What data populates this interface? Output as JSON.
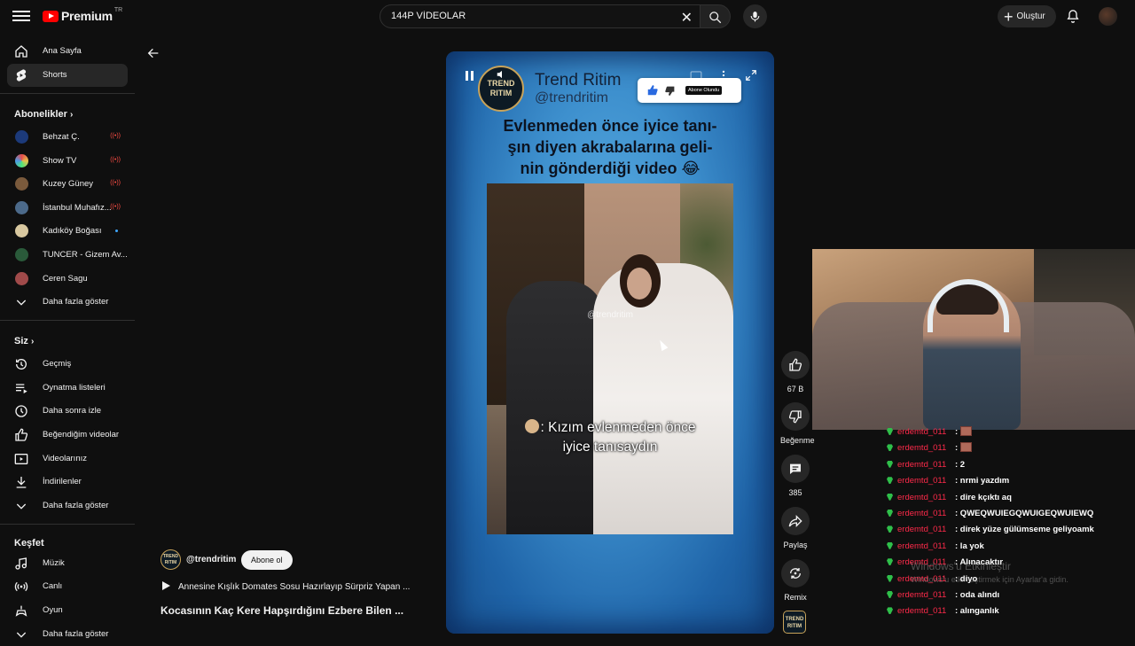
{
  "header": {
    "brand": "Premium",
    "region": "TR",
    "search_value": "144P VİDEOLAR",
    "create_label": "Oluştur"
  },
  "sidebar": {
    "main": [
      {
        "label": "Ana Sayfa",
        "icon": "home-icon"
      },
      {
        "label": "Shorts",
        "icon": "shorts-icon",
        "active": true
      }
    ],
    "subscriptions_title": "Abonelikler",
    "subscriptions": [
      {
        "label": "Behzat Ç.",
        "status": "live",
        "color": "#1c3a7a"
      },
      {
        "label": "Show TV",
        "status": "live",
        "color": "#e6c04c"
      },
      {
        "label": "Kuzey Güney",
        "status": "live",
        "color": "#7a5a3c"
      },
      {
        "label": "İstanbul Muhafız...",
        "status": "live",
        "color": "#4c6a8a"
      },
      {
        "label": "Kadıköy Boğası",
        "status": "new",
        "color": "#d8c8a0"
      },
      {
        "label": "TUNCER - Gizem Av...",
        "status": "",
        "color": "#2a5a3a"
      },
      {
        "label": "Ceren Sagu",
        "status": "",
        "color": "#a04a4a"
      }
    ],
    "subs_more": "Daha fazla göster",
    "you_title": "Siz",
    "you_items": [
      {
        "label": "Geçmiş",
        "icon": "history-icon"
      },
      {
        "label": "Oynatma listeleri",
        "icon": "playlist-icon"
      },
      {
        "label": "Daha sonra izle",
        "icon": "clock-icon"
      },
      {
        "label": "Beğendiğim videolar",
        "icon": "thumbs-up-icon"
      },
      {
        "label": "Videolarınız",
        "icon": "video-icon"
      },
      {
        "label": "İndirilenler",
        "icon": "download-icon"
      }
    ],
    "you_more": "Daha fazla göster",
    "explore_title": "Keşfet",
    "explore_items": [
      {
        "label": "Müzik",
        "icon": "music-icon"
      },
      {
        "label": "Canlı",
        "icon": "live-icon"
      },
      {
        "label": "Oyun",
        "icon": "gamepad-icon"
      }
    ],
    "explore_more": "Daha fazla göster"
  },
  "short": {
    "channel_name": "Trend Ritim",
    "channel_handle": "@trendritim",
    "logo_text_1": "TREND",
    "logo_text_2": "RITIM",
    "subscribed_tag": "Abone Olundu",
    "headline_1": "Evlenmeden önce iyice tanı-",
    "headline_2": "şın diyen akrabalarına geli-",
    "headline_3": "nin gönderdiği video 😂",
    "watermark": "@trendritim",
    "caption_1": ": Kızım evlenmeden önce",
    "caption_2": "iyice tanısaydın"
  },
  "actions": {
    "likes": "67 B",
    "dislike": "Beğenme",
    "comments": "385",
    "share": "Paylaş",
    "remix": "Remix"
  },
  "below": {
    "handle": "@trendritim",
    "subscribe": "Abone ol",
    "music_title": "Annesine Kışlık Domates Sosu Hazırlayıp Sürpriz Yapan ...",
    "next_title": "Kocasının Kaç Kere Hapşırdığını Ezbere Bilen ..."
  },
  "chat": [
    {
      "user": "erdemtd_011",
      "msg": ":",
      "img": true
    },
    {
      "user": "erdemtd_011",
      "msg": ":",
      "img": true
    },
    {
      "user": "erdemtd_011",
      "msg": ": 2"
    },
    {
      "user": "erdemtd_011",
      "msg": ": nrmi yazdım"
    },
    {
      "user": "erdemtd_011",
      "msg": ": dire kçıktı aq"
    },
    {
      "user": "erdemtd_011",
      "msg": ": QWEQWUIEGQWUIGEQWUIEWQ"
    },
    {
      "user": "erdemtd_011",
      "msg": ": direk yüze gülümseme geliyoamk"
    },
    {
      "user": "erdemtd_011",
      "msg": ": la yok"
    },
    {
      "user": "erdemtd_011",
      "msg": ": Alınacaktır"
    },
    {
      "user": "erdemtd_011",
      "msg": ": diyo"
    },
    {
      "user": "erdemtd_011",
      "msg": ": oda alındı"
    },
    {
      "user": "erdemtd_011",
      "msg": ": alınganlık"
    }
  ],
  "windows_watermark": {
    "line1": "Windows'u Etkinleştir",
    "line2": "Windows'u etkinleştirmek için Ayarlar'a gidin."
  }
}
